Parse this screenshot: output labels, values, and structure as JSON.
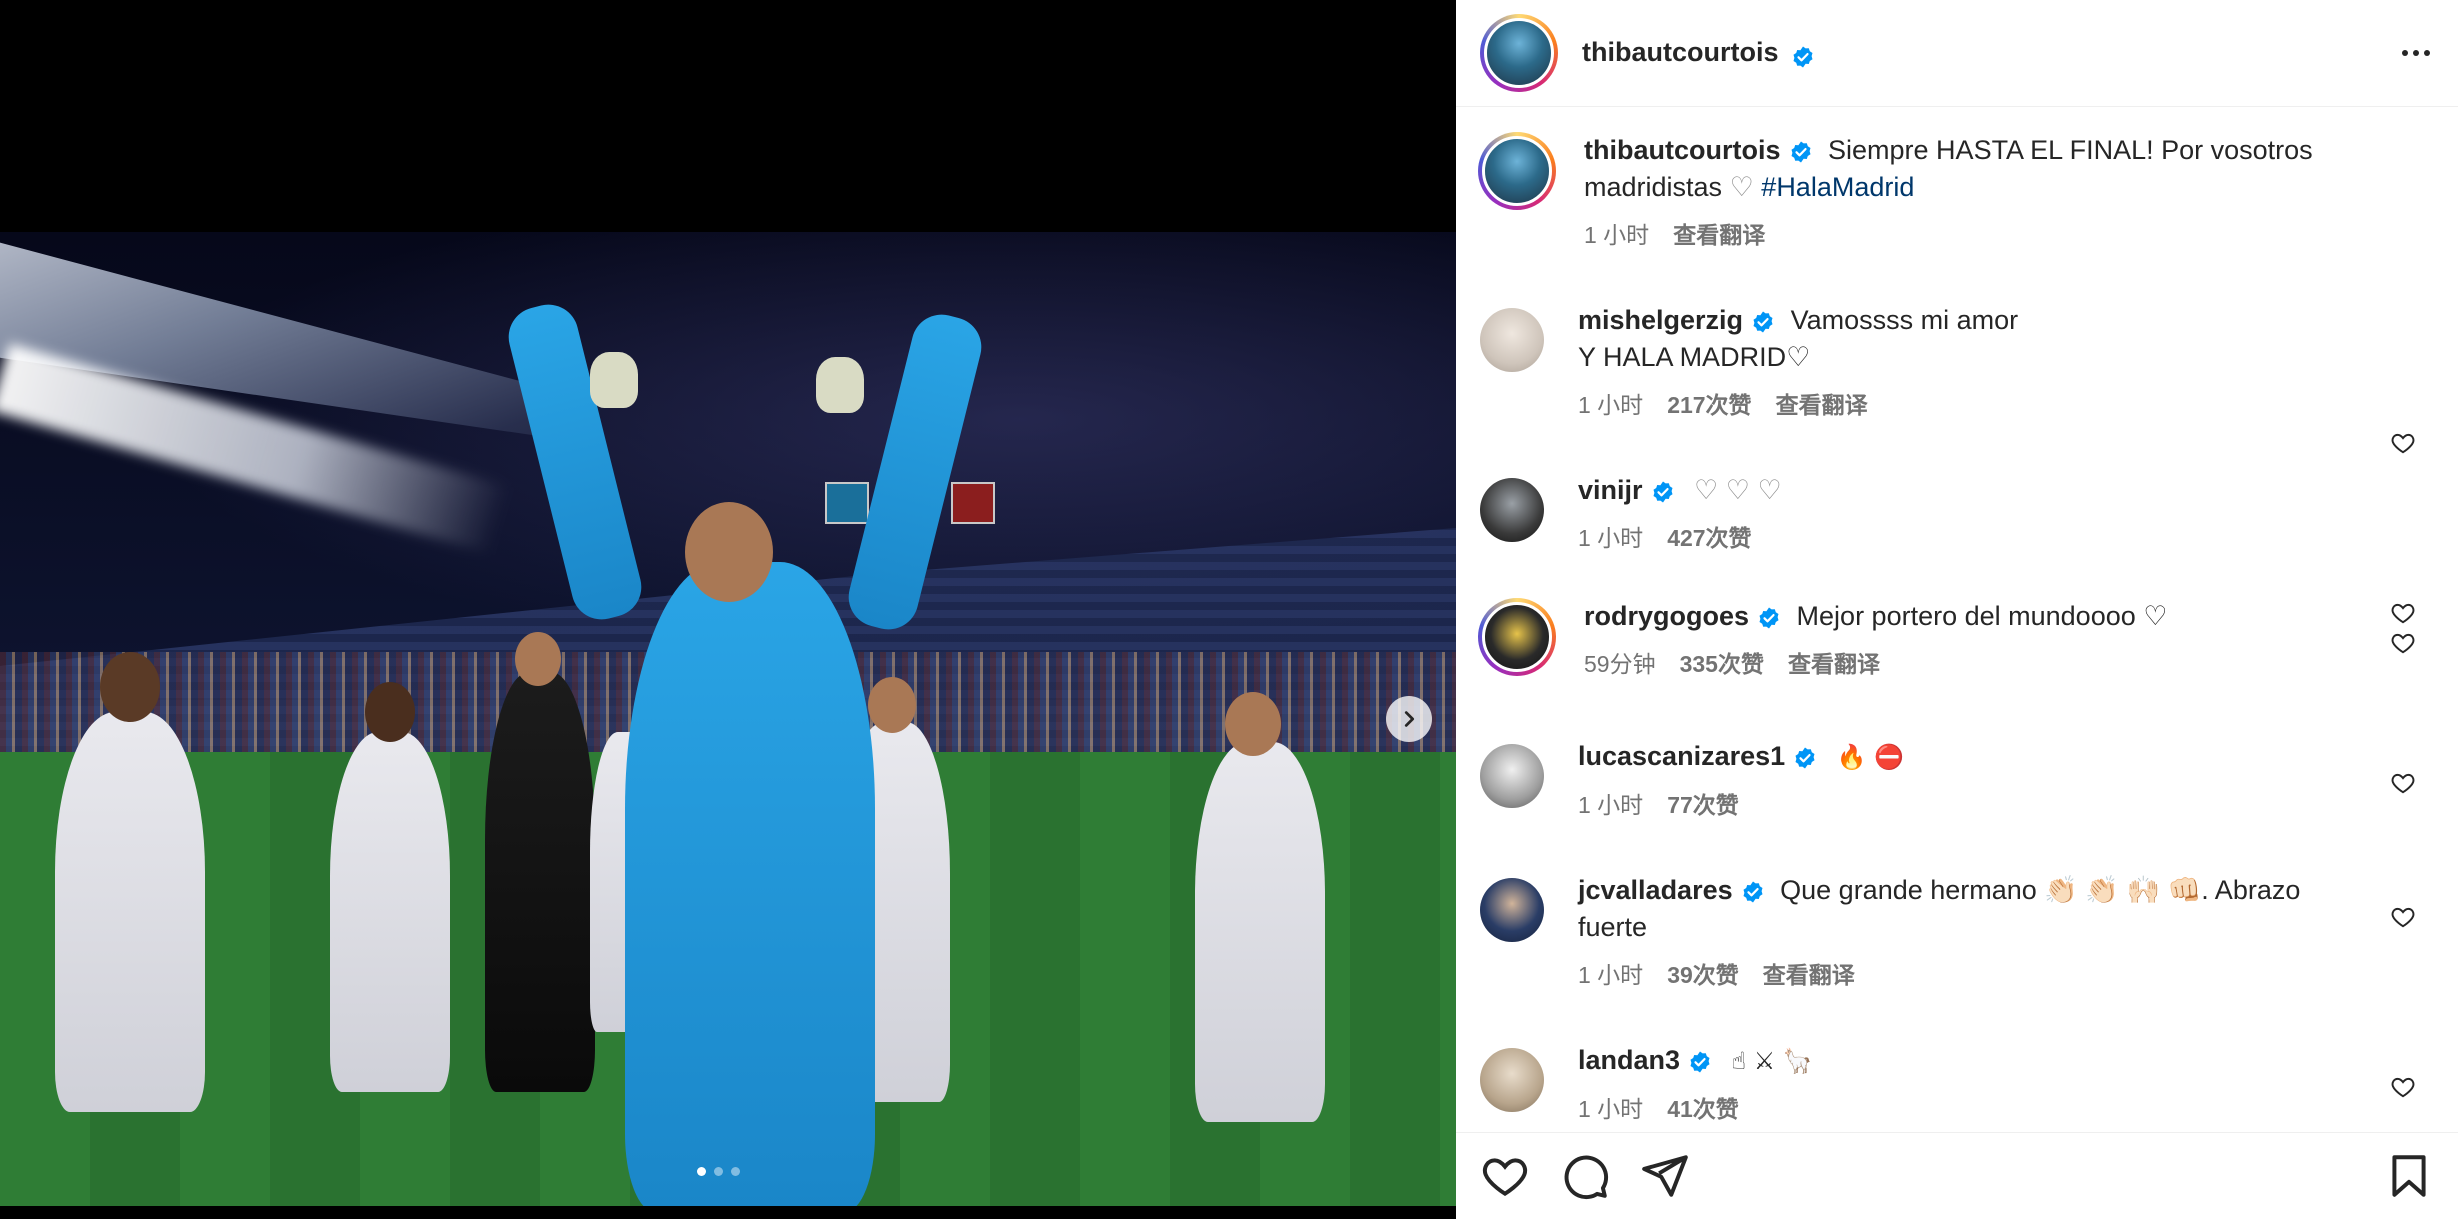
{
  "post": {
    "author": "thibautcourtois",
    "caption_text": "Siempre HASTA EL FINAL! Por vosotros madridistas",
    "caption_heart": "♡",
    "caption_hashtag": "#HalaMadrid",
    "caption_time": "1 小时",
    "caption_translate": "查看翻译",
    "carousel": {
      "total": 3,
      "active": 1
    }
  },
  "comments": [
    {
      "user": "mishelgerzig",
      "text": "Vamossss mi amor",
      "text2": "Y HALA MADRID♡",
      "time": "1 小时",
      "likes": "217次赞",
      "translate": "查看翻译",
      "avatar_color": "#d8d2c8"
    },
    {
      "user": "vinijr",
      "text": "♡ ♡ ♡",
      "time": "1 小时",
      "likes": "427次赞",
      "avatar_color": "#2b2b2b"
    },
    {
      "user": "rodrygogoes",
      "text": "Mejor portero del mundoooo ♡",
      "time": "59分钟",
      "likes": "335次赞",
      "translate": "查看翻译",
      "avatar_color": "#1e1e1e"
    },
    {
      "user": "lucascanizares1",
      "text": "🔥 ⛔",
      "time": "1 小时",
      "likes": "77次赞",
      "avatar_color": "#bdbdbd"
    },
    {
      "user": "jcvalladares",
      "text": "Que grande hermano 👏🏻 👏🏻 🙌🏻 👊🏻. Abrazo",
      "text2": "fuerte",
      "time": "1 小时",
      "likes": "39次赞",
      "translate": "查看翻译",
      "avatar_color": "#2c3e60"
    },
    {
      "user": "landan3",
      "text": "☝ ⚔ 🦙",
      "time": "1 小时",
      "likes": "41次赞",
      "avatar_color": "#c7b9a4"
    }
  ],
  "icons": {
    "like": "heart-icon",
    "comment": "comment-icon",
    "share": "share-icon",
    "save": "bookmark-icon",
    "more": "more-options-icon",
    "verified": "verified-badge-icon",
    "next": "chevron-right-icon"
  },
  "colors": {
    "verified": "#0095f6",
    "hashtag": "#00376b",
    "secondary_text": "#737373"
  }
}
